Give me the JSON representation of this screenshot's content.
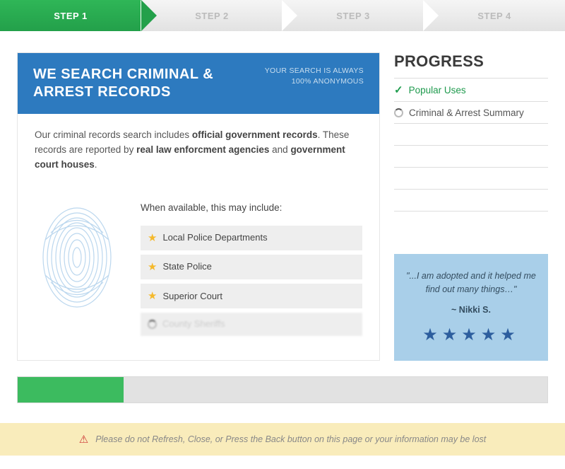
{
  "steps": [
    "STEP 1",
    "STEP 2",
    "STEP 3",
    "STEP 4"
  ],
  "active_step_index": 0,
  "panel": {
    "title": "WE SEARCH CRIMINAL & ARREST RECORDS",
    "subtitle_line1": "YOUR SEARCH IS ALWAYS",
    "subtitle_line2": "100% ANONYMOUS",
    "desc_pre": "Our criminal records search includes ",
    "desc_bold1": "official government records",
    "desc_mid": ". These records are reported by ",
    "desc_bold2": "real law enforcment agencies",
    "desc_mid2": " and ",
    "desc_bold3": "government court houses",
    "desc_end": "."
  },
  "includes": {
    "title": "When available, this may include:",
    "items": [
      "Local Police Departments",
      "State Police",
      "Superior Court"
    ],
    "loading_item": "County Sheriffs"
  },
  "progress": {
    "title": "PROGRESS",
    "done_item": "Popular Uses",
    "loading_item": "Criminal & Arrest Summary"
  },
  "testimonial": {
    "quote": "\"...I am adopted and it helped me find out many things…\"",
    "author": "~ Nikki S.",
    "stars": 5
  },
  "progress_percent": 20,
  "warning": "Please do not Refresh, Close, or Press the Back button on this page or your information may be lost"
}
